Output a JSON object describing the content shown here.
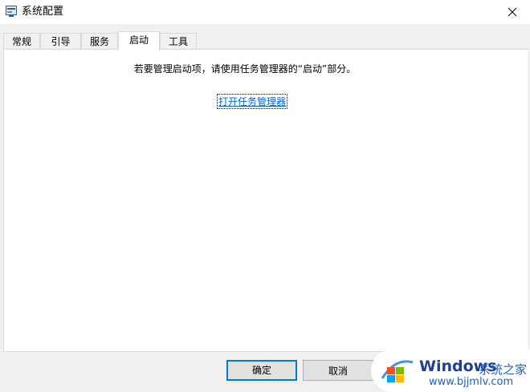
{
  "window": {
    "title": "系统配置"
  },
  "tabs": [
    {
      "label": "常规"
    },
    {
      "label": "引导"
    },
    {
      "label": "服务"
    },
    {
      "label": "启动",
      "active": true
    },
    {
      "label": "工具"
    }
  ],
  "startup": {
    "hint": "若要管理启动项，请使用任务管理器的“启动”部分。",
    "link_label": "打开任务管理器"
  },
  "buttons": {
    "ok_label": "确定",
    "cancel_label": "取消"
  },
  "watermark": {
    "title": "Windows",
    "subtitle": "系统之家",
    "url": "www.bjjmlv.com"
  },
  "colors": {
    "link": "#0066cc",
    "focus_border": "#0078d7"
  },
  "icons": {
    "app": "system-config-icon",
    "close": "close-icon"
  }
}
